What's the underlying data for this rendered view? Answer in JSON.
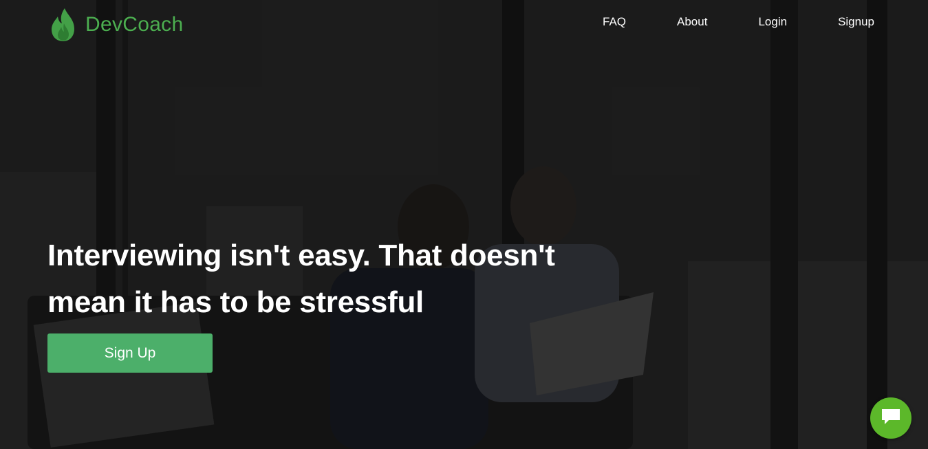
{
  "brand": {
    "name": "DevCoach",
    "color": "#4caf50",
    "icon": "flame-icon"
  },
  "nav": {
    "items": [
      {
        "label": "FAQ"
      },
      {
        "label": "About"
      },
      {
        "label": "Login"
      },
      {
        "label": "Signup"
      }
    ]
  },
  "hero": {
    "headline": "Interviewing isn't easy. That doesn't mean it has to be stressful",
    "cta_label": "Sign Up",
    "cta_color": "#4caf6a"
  },
  "chat_widget": {
    "icon": "chat-bubble-icon",
    "color": "#5cb82a"
  }
}
